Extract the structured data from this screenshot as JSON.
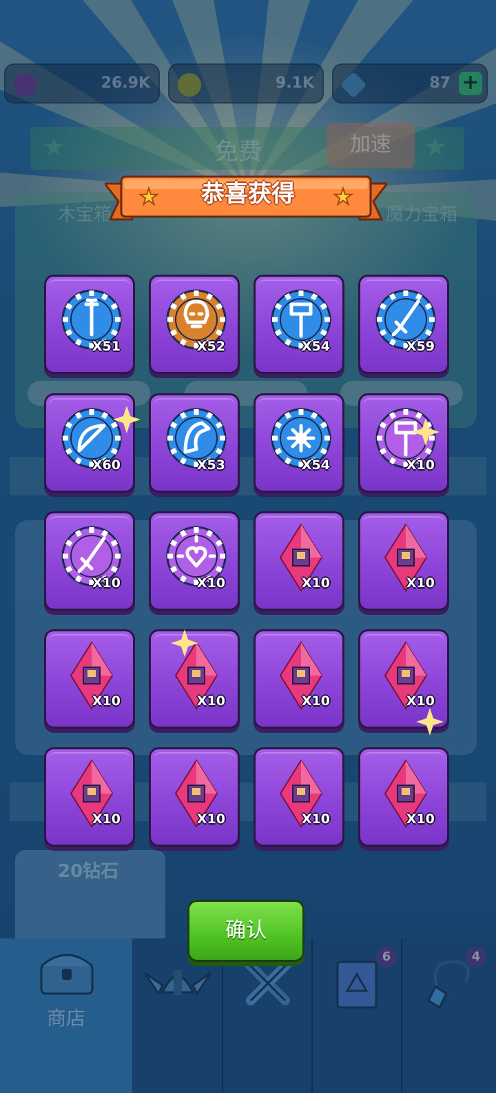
{
  "colors": {
    "card_purple": "#8d45d8",
    "chip_blue": "#2f8de8",
    "chip_orange": "#d9822b",
    "chip_purple": "#b15fe6",
    "gem_pink": "#e9397d",
    "ribbon_orange": "#ff8a3d",
    "confirm_green": "#50c324"
  },
  "currency": {
    "purple_coins": "26.9K",
    "gold_coins": "9.1K",
    "diamonds": "87",
    "add_label": "+"
  },
  "shop": {
    "free_label": "免费",
    "speed_label": "加速",
    "chest_titles": [
      "木宝箱",
      "魔力宝箱"
    ],
    "diamond_offer": "20钻石"
  },
  "popup": {
    "title": "恭喜获得",
    "confirm_label": "确认",
    "rewards": [
      {
        "kind": "chip",
        "icon": "staff-icon",
        "color": "blue",
        "qty": "X51"
      },
      {
        "kind": "chip",
        "icon": "skull-icon",
        "color": "orange",
        "qty": "X52"
      },
      {
        "kind": "chip",
        "icon": "hammer-icon",
        "color": "blue",
        "qty": "X54"
      },
      {
        "kind": "chip",
        "icon": "dagger-icon",
        "color": "blue",
        "qty": "X59"
      },
      {
        "kind": "chip",
        "icon": "bow-icon",
        "color": "blue",
        "qty": "X60"
      },
      {
        "kind": "chip",
        "icon": "dragon-icon",
        "color": "blue",
        "qty": "X53"
      },
      {
        "kind": "chip",
        "icon": "eye-burst-icon",
        "color": "blue",
        "qty": "X54"
      },
      {
        "kind": "chip",
        "icon": "hammer-icon",
        "color": "purple",
        "qty": "X10"
      },
      {
        "kind": "chip",
        "icon": "dagger-icon",
        "color": "purple",
        "qty": "X10"
      },
      {
        "kind": "chip",
        "icon": "heart-burst-icon",
        "color": "purple",
        "qty": "X10"
      },
      {
        "kind": "gem",
        "icon": "hero-shard-icon",
        "color": "pink",
        "qty": "X10"
      },
      {
        "kind": "gem",
        "icon": "hero-shard-icon",
        "color": "pink",
        "qty": "X10"
      },
      {
        "kind": "gem",
        "icon": "hero-shard-icon",
        "color": "pink",
        "qty": "X10"
      },
      {
        "kind": "gem",
        "icon": "hero-shard-icon",
        "color": "pink",
        "qty": "X10"
      },
      {
        "kind": "gem",
        "icon": "hero-shard-icon",
        "color": "pink",
        "qty": "X10"
      },
      {
        "kind": "gem",
        "icon": "hero-shard-icon",
        "color": "pink",
        "qty": "X10"
      },
      {
        "kind": "gem",
        "icon": "hero-shard-icon",
        "color": "pink",
        "qty": "X10"
      },
      {
        "kind": "gem",
        "icon": "hero-shard-icon",
        "color": "pink",
        "qty": "X10"
      },
      {
        "kind": "gem",
        "icon": "hero-shard-icon",
        "color": "pink",
        "qty": "X10"
      },
      {
        "kind": "gem",
        "icon": "hero-shard-icon",
        "color": "pink",
        "qty": "X10"
      }
    ]
  },
  "nav": {
    "tabs": [
      {
        "icon": "chest-icon",
        "label": "商店"
      },
      {
        "icon": "winged-helmet-icon"
      },
      {
        "icon": "crossed-swords-icon"
      },
      {
        "icon": "spellbook-icon",
        "badge": "6"
      },
      {
        "icon": "amulet-icon",
        "badge": "4"
      }
    ]
  }
}
